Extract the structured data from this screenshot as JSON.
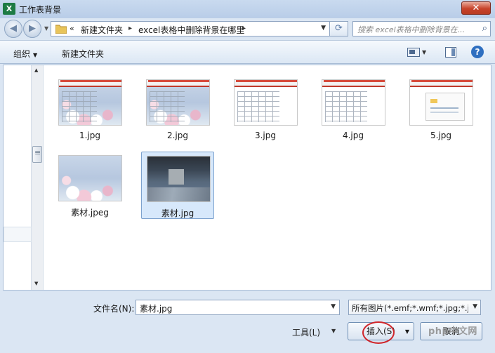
{
  "window": {
    "app_icon": "X",
    "title": "工作表背景",
    "close_label": "✕"
  },
  "navigation": {
    "back_icon": "arrow-left-icon",
    "forward_icon": "arrow-right-icon",
    "breadcrumb_prefix": "«",
    "breadcrumb": [
      "新建文件夹",
      "excel表格中删除背景在哪里"
    ],
    "search_placeholder": "搜索 excel表格中删除背景在..."
  },
  "toolbar": {
    "organize_label": "组织",
    "new_folder_label": "新建文件夹"
  },
  "files": [
    {
      "name": "1.jpg",
      "thumb": "flowers-sheet",
      "selected": false
    },
    {
      "name": "2.jpg",
      "thumb": "flowers-sheet",
      "selected": false
    },
    {
      "name": "3.jpg",
      "thumb": "sheet",
      "selected": false
    },
    {
      "name": "4.jpg",
      "thumb": "sheet",
      "selected": false
    },
    {
      "name": "5.jpg",
      "thumb": "sheet-dialog",
      "selected": false
    },
    {
      "name": "素材.jpeg",
      "thumb": "flowers",
      "selected": false
    },
    {
      "name": "素材.jpg",
      "thumb": "photo",
      "selected": true
    }
  ],
  "footer": {
    "filename_label": "文件名(N):",
    "filename_value": "素材.jpg",
    "filter_value": "所有图片(*.emf;*.wmf;*.jpg;*.jp",
    "tools_label": "工具(L)",
    "insert_label": "插入(S)",
    "cancel_label": "取消",
    "watermark": "php中文网"
  },
  "colors": {
    "accent": "#2f6fc0",
    "selection": "#d7e8fb",
    "close": "#c7432a",
    "highlight_circle": "#d0262b"
  }
}
